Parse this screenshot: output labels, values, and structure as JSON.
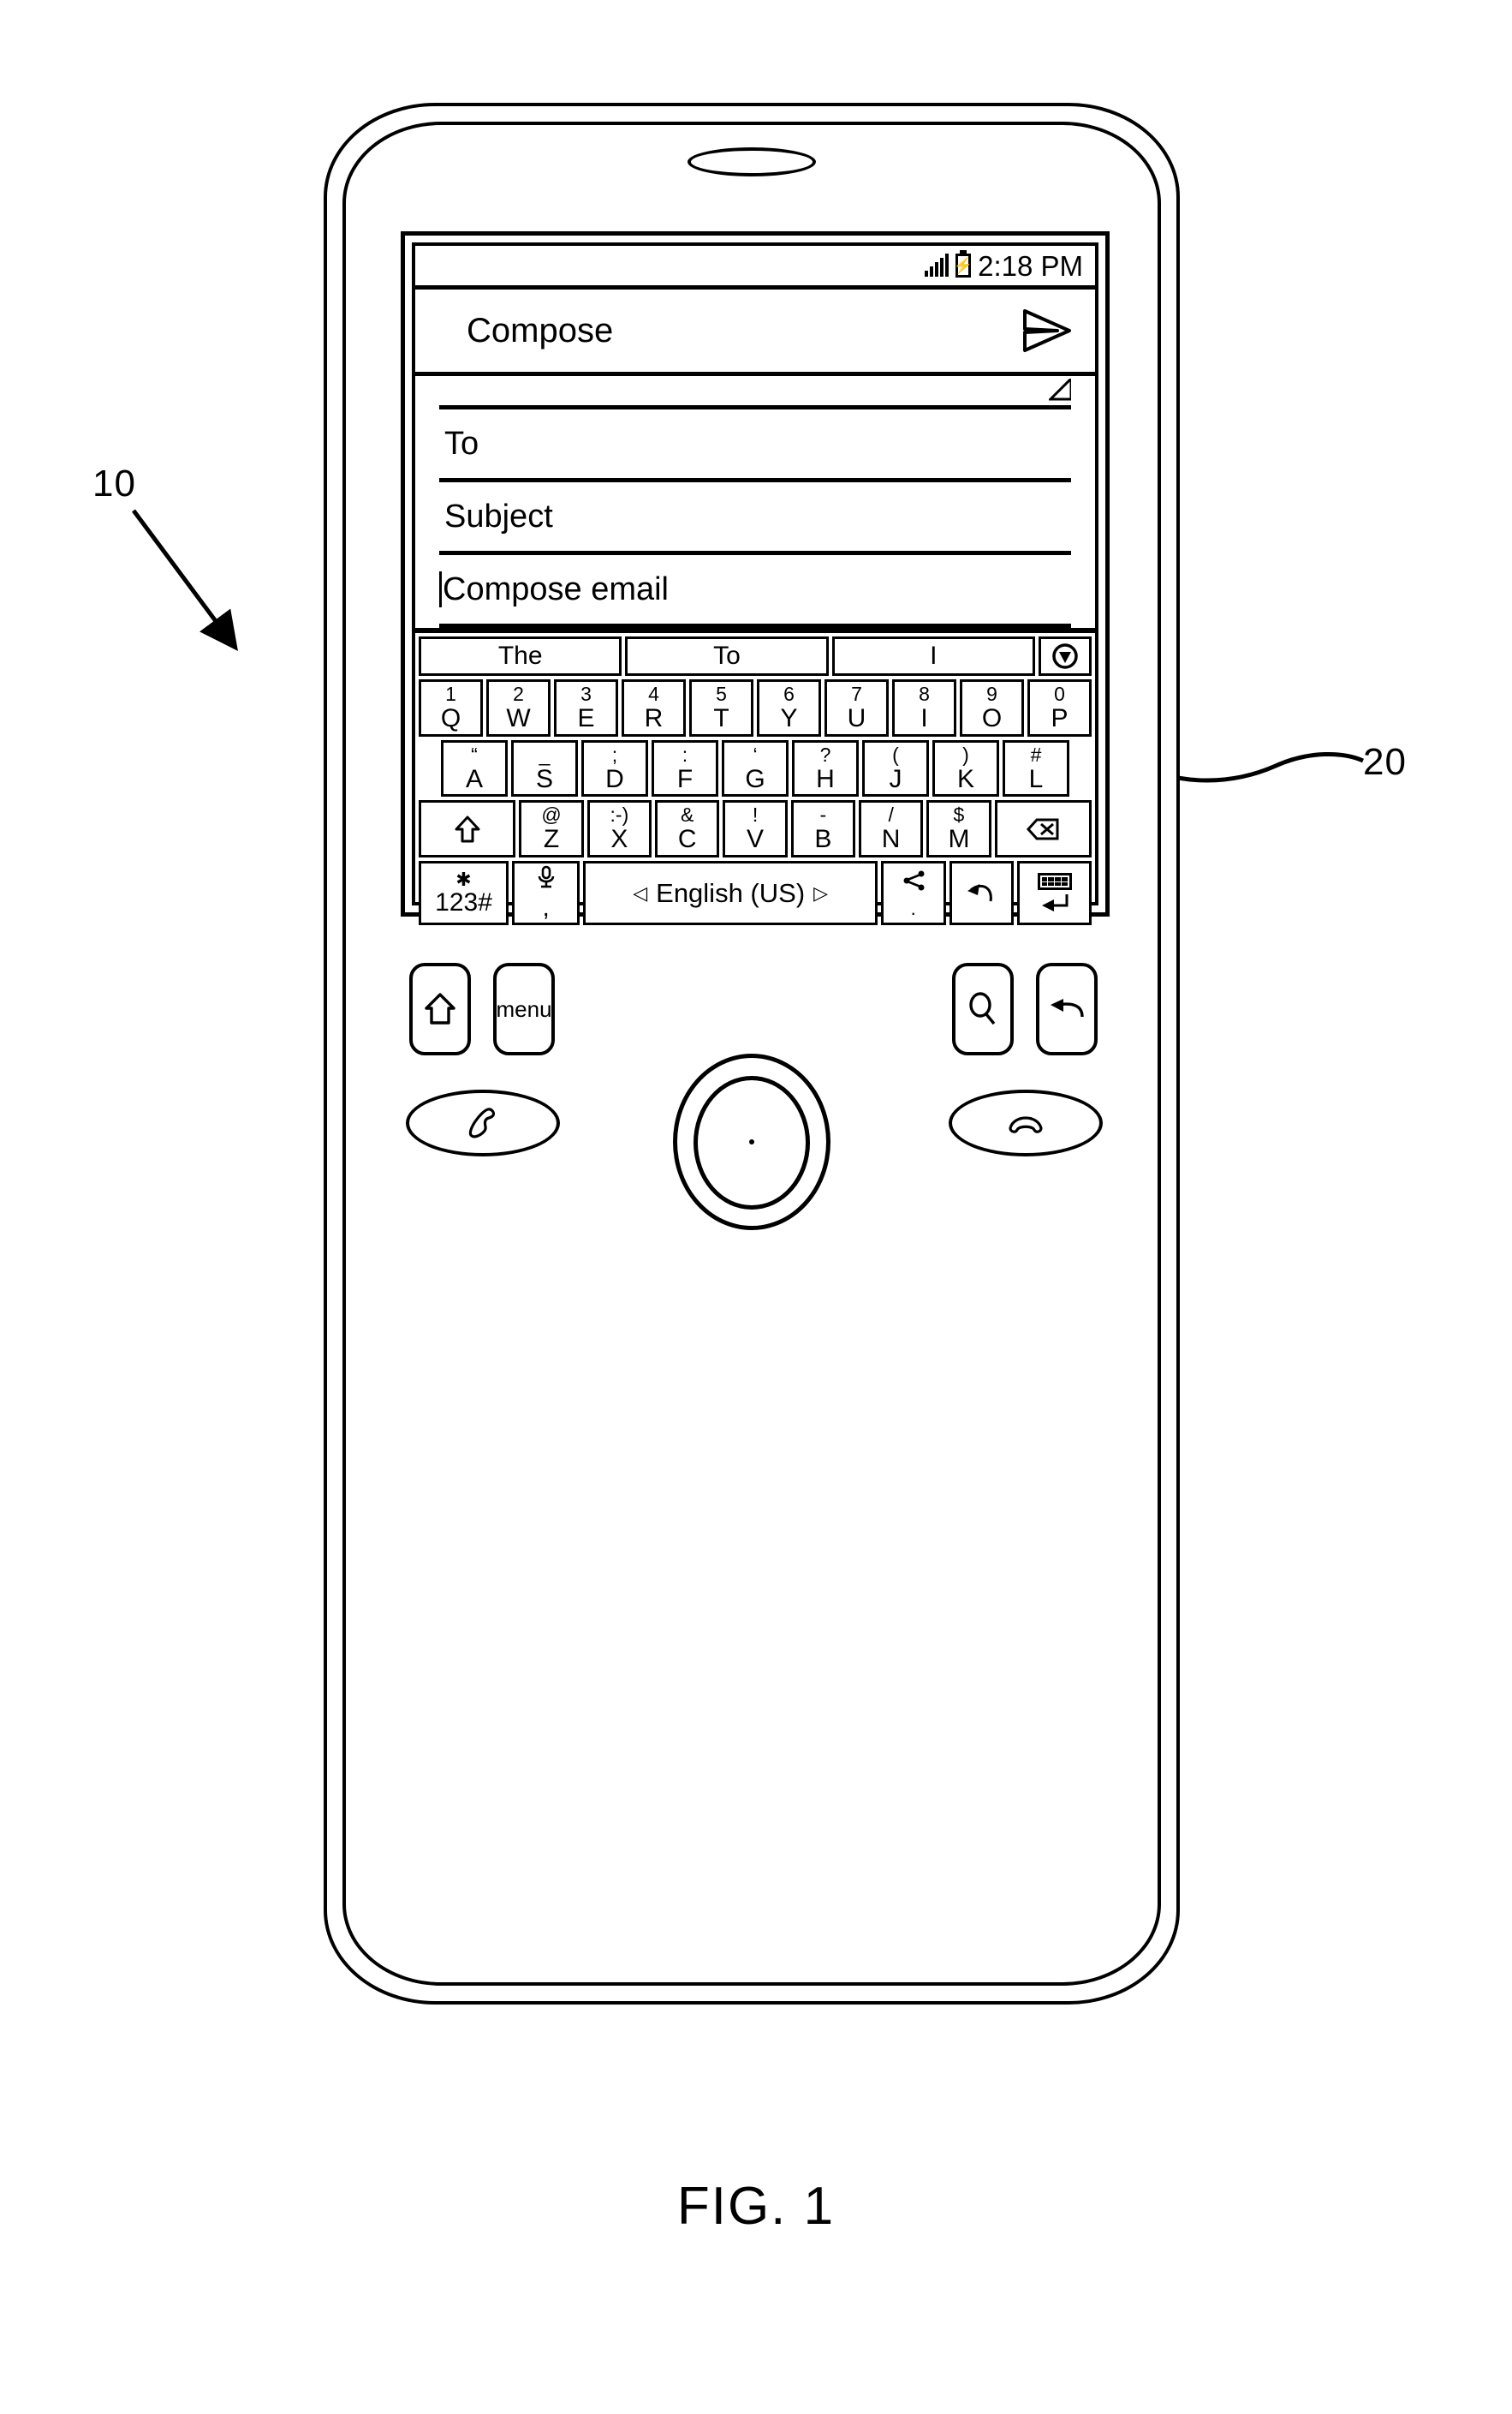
{
  "figure": {
    "caption": "FIG. 1",
    "reference_numerals": [
      {
        "id": "10",
        "label": "10"
      },
      {
        "id": "20",
        "label": "20"
      }
    ]
  },
  "device": {
    "name": "mobile-phone",
    "earpiece": "speaker-grille"
  },
  "screen": {
    "status_bar": {
      "signal_icon": "signal-bars-icon",
      "battery_icon": "battery-charging-icon",
      "battery_glyph": "⚡",
      "time": "2:18 PM"
    },
    "header": {
      "title": "Compose",
      "send_icon": "send-paper-plane-icon"
    },
    "form": {
      "attachment_row_icon": "corner-fold-icon",
      "fields": [
        {
          "name": "to",
          "label": "To",
          "value": ""
        },
        {
          "name": "subject",
          "label": "Subject",
          "value": ""
        }
      ],
      "body": {
        "name": "compose-email",
        "label": "Compose email",
        "value": "",
        "caret": true
      }
    }
  },
  "keyboard": {
    "suggestions": [
      {
        "label": "The"
      },
      {
        "label": "To"
      },
      {
        "label": "I"
      }
    ],
    "suggestion_more_icon": "chevron-down-circle-icon",
    "rows": [
      {
        "name": "number-letter-row",
        "keys": [
          {
            "sub": "1",
            "main": "Q"
          },
          {
            "sub": "2",
            "main": "W"
          },
          {
            "sub": "3",
            "main": "E"
          },
          {
            "sub": "4",
            "main": "R"
          },
          {
            "sub": "5",
            "main": "T"
          },
          {
            "sub": "6",
            "main": "Y"
          },
          {
            "sub": "7",
            "main": "U"
          },
          {
            "sub": "8",
            "main": "I"
          },
          {
            "sub": "9",
            "main": "O"
          },
          {
            "sub": "0",
            "main": "P"
          }
        ]
      },
      {
        "name": "home-row",
        "keys": [
          {
            "sub": "“",
            "main": "A"
          },
          {
            "sub": "_",
            "main": "S"
          },
          {
            "sub": ";",
            "main": "D"
          },
          {
            "sub": ":",
            "main": "F"
          },
          {
            "sub": "‘",
            "main": "G"
          },
          {
            "sub": "?",
            "main": "H"
          },
          {
            "sub": "(",
            "main": "J"
          },
          {
            "sub": ")",
            "main": "K"
          },
          {
            "sub": "#",
            "main": "L"
          }
        ]
      },
      {
        "name": "bottom-letter-row",
        "keys": [
          {
            "sub": "@",
            "main": "Z"
          },
          {
            "sub": ":-)",
            "main": "X"
          },
          {
            "sub": "&",
            "main": "C"
          },
          {
            "sub": "!",
            "main": "V"
          },
          {
            "sub": "-",
            "main": "B"
          },
          {
            "sub": "/",
            "main": "N"
          },
          {
            "sub": "$",
            "main": "M"
          }
        ]
      }
    ],
    "shift_key": {
      "name": "shift-key",
      "icon": "shift-arrow-icon",
      "glyph": "⇧"
    },
    "backspace_key": {
      "name": "backspace-key",
      "icon": "backspace-icon",
      "glyph": "⌧"
    },
    "symbol_key": {
      "name": "symbol-key",
      "icon": "asterisk-icon",
      "glyph": "✱",
      "label": "123#"
    },
    "mic_comma_key": {
      "name": "mic-comma-key",
      "icon": "microphone-icon",
      "glyph": "ᵟ",
      "label": ","
    },
    "space_key": {
      "name": "space-key",
      "label": "English (US)",
      "left_arrow": "◁",
      "right_arrow": "▷"
    },
    "dot_key": {
      "name": "period-key",
      "icon": "share-icon",
      "glyph": "≺",
      "label": "."
    },
    "undo_key": {
      "name": "undo-key",
      "icon": "undo-arrow-icon",
      "glyph": "↶"
    },
    "enter_key": {
      "name": "enter-key",
      "icon": "keyboard-icon",
      "glyph": "↵"
    }
  },
  "hardware_buttons": [
    {
      "name": "home-button",
      "icon": "home-icon",
      "glyph": "⌂",
      "label": ""
    },
    {
      "name": "menu-button",
      "icon": "menu-text-icon",
      "glyph": "",
      "label": "menu"
    },
    {
      "name": "search-button",
      "icon": "magnifier-icon",
      "glyph": "",
      "label": ""
    },
    {
      "name": "back-button",
      "icon": "back-arrow-icon",
      "glyph": "↩",
      "label": ""
    },
    {
      "name": "call-button",
      "icon": "handset-call-icon",
      "glyph": "",
      "label": ""
    },
    {
      "name": "end-call-button",
      "icon": "handset-end-icon",
      "glyph": "",
      "label": ""
    }
  ],
  "trackball": {
    "name": "trackball",
    "label": ""
  }
}
